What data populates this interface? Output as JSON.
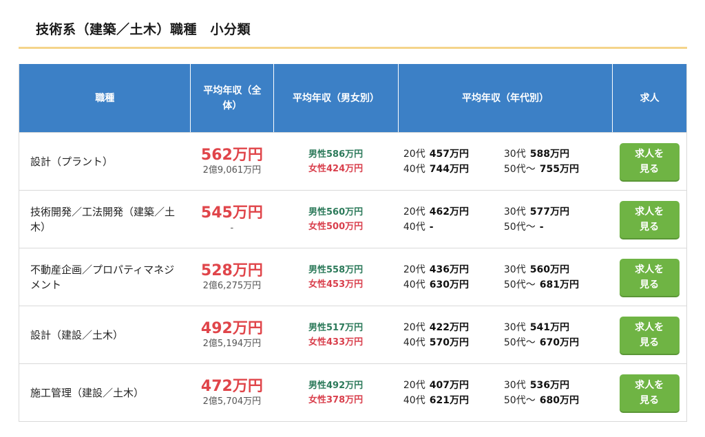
{
  "page_title": "技術系（建築／土木）職種　小分類",
  "colors": {
    "header_bg": "#3c80c6",
    "accent_rule": "#f5d48a",
    "salary_red": "#e0454a",
    "male_green": "#2c7a5a",
    "female_red": "#d9404d",
    "button_green": "#6fb444"
  },
  "table": {
    "headers": {
      "job": "職種",
      "avg_total": "平均年収（全体）",
      "avg_gender": "平均年収（男女別）",
      "avg_age": "平均年収（年代別）",
      "jobs": "求人"
    },
    "rows": [
      {
        "job": "設計（プラント）",
        "avg": "562万円",
        "total": "2億9,061万円",
        "male": "男性586万円",
        "female": "女性424万円",
        "ages": [
          {
            "label": "20代",
            "value": "457万円"
          },
          {
            "label": "30代",
            "value": "588万円"
          },
          {
            "label": "40代",
            "value": "744万円"
          },
          {
            "label": "50代〜",
            "value": "755万円"
          }
        ],
        "button": "求人を見る"
      },
      {
        "job": "技術開発／工法開発（建築／土木）",
        "avg": "545万円",
        "total": "-",
        "male": "男性560万円",
        "female": "女性500万円",
        "ages": [
          {
            "label": "20代",
            "value": "462万円"
          },
          {
            "label": "30代",
            "value": "577万円"
          },
          {
            "label": "40代",
            "value": "-"
          },
          {
            "label": "50代〜",
            "value": "-"
          }
        ],
        "button": "求人を見る"
      },
      {
        "job": "不動産企画／プロパティマネジメント",
        "avg": "528万円",
        "total": "2億6,275万円",
        "male": "男性558万円",
        "female": "女性453万円",
        "ages": [
          {
            "label": "20代",
            "value": "436万円"
          },
          {
            "label": "30代",
            "value": "560万円"
          },
          {
            "label": "40代",
            "value": "630万円"
          },
          {
            "label": "50代〜",
            "value": "681万円"
          }
        ],
        "button": "求人を見る"
      },
      {
        "job": "設計（建設／土木）",
        "avg": "492万円",
        "total": "2億5,194万円",
        "male": "男性517万円",
        "female": "女性433万円",
        "ages": [
          {
            "label": "20代",
            "value": "422万円"
          },
          {
            "label": "30代",
            "value": "541万円"
          },
          {
            "label": "40代",
            "value": "570万円"
          },
          {
            "label": "50代〜",
            "value": "670万円"
          }
        ],
        "button": "求人を見る"
      },
      {
        "job": "施工管理（建設／土木）",
        "avg": "472万円",
        "total": "2億5,704万円",
        "male": "男性492万円",
        "female": "女性378万円",
        "ages": [
          {
            "label": "20代",
            "value": "407万円"
          },
          {
            "label": "30代",
            "value": "536万円"
          },
          {
            "label": "40代",
            "value": "621万円"
          },
          {
            "label": "50代〜",
            "value": "680万円"
          }
        ],
        "button": "求人を見る"
      }
    ]
  }
}
